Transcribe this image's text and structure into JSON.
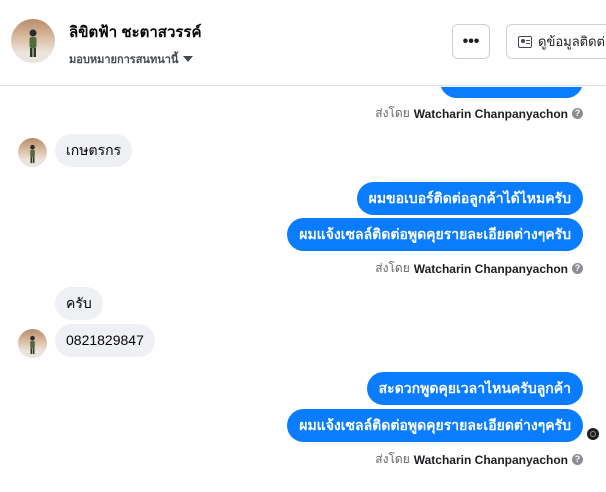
{
  "header": {
    "contact_name": "ลิขิตฟ้า ชะตาสวรรค์",
    "assign_label": "มอบหมายการสนทนานี้",
    "more_label": "•••",
    "contact_info_label": "ดูข้อมูลติดต่อ"
  },
  "thread": {
    "sender_prefix": "ส่งโดย",
    "sender_name": "Watcharin Chanpanyachon",
    "info_glyph": "?",
    "messages": [
      {
        "direction": "in",
        "text": "เกษตรกร"
      },
      {
        "direction": "out",
        "text": "ผมขอเบอร์ติดต่อลูกค้าได้ไหมครับ"
      },
      {
        "direction": "out",
        "text": "ผมแจ้งเซลล์ติดต่อพูดคุยรายละเอียดต่างๆครับ"
      },
      {
        "direction": "in",
        "text": "ครับ"
      },
      {
        "direction": "in",
        "text": "0821829847"
      },
      {
        "direction": "out",
        "text": "สะดวกพูดคุยเวลาไหนครับลูกค้า"
      },
      {
        "direction": "out",
        "text": "ผมแจ้งเซลล์ติดต่อพูดคุยรายละเอียดต่างๆครับ"
      }
    ]
  },
  "icons": {
    "caret": "chevron-down-icon",
    "contact_card": "contact-card-icon",
    "info": "info-icon",
    "seen": "seen-avatar-icon"
  },
  "colors": {
    "outgoing_bubble": "#0a7cff",
    "incoming_bubble": "#eef0f3",
    "secondary_text": "#65676b"
  }
}
